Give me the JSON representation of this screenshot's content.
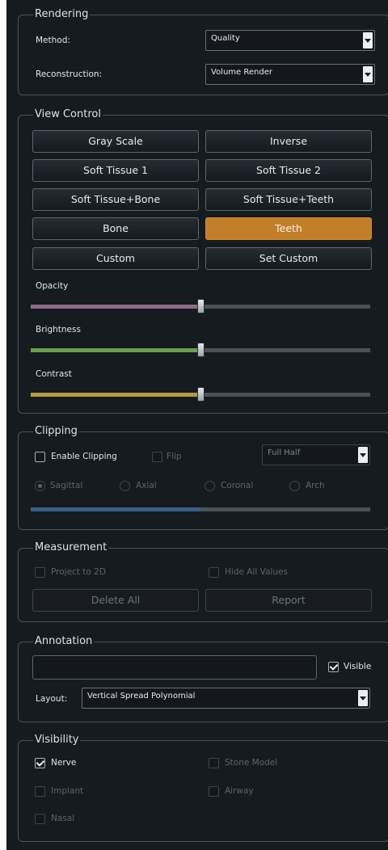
{
  "rendering": {
    "title": "Rendering",
    "method_label": "Method:",
    "method_value": "Quality",
    "reconstruction_label": "Reconstruction:",
    "reconstruction_value": "Volume Render"
  },
  "view_control": {
    "title": "View Control",
    "buttons": [
      "Gray Scale",
      "Inverse",
      "Soft Tissue 1",
      "Soft Tissue 2",
      "Soft Tissue+Bone",
      "Soft Tissue+Teeth",
      "Bone",
      "Teeth",
      "Custom",
      "Set Custom"
    ],
    "active_button": "Teeth",
    "opacity_label": "Opacity",
    "brightness_label": "Brightness",
    "contrast_label": "Contrast",
    "opacity_value": 0.5,
    "brightness_value": 0.5,
    "contrast_value": 0.5,
    "colors": {
      "opacity": "#8f6b85",
      "brightness": "#6aa04a",
      "contrast": "#b59a42",
      "active": "#c27e28"
    }
  },
  "clipping": {
    "title": "Clipping",
    "enable_label": "Enable Clipping",
    "enable_checked": false,
    "flip_label": "Flip",
    "mode_value": "Full Half",
    "planes": [
      "Sagittal",
      "Axial",
      "Coronal",
      "Arch"
    ],
    "selected_plane": "Sagittal",
    "position_value": 0.5,
    "colors": {
      "position": "#3a5f8a"
    }
  },
  "measurement": {
    "title": "Measurement",
    "project_label": "Project to 2D",
    "hide_values_label": "Hide All Values",
    "delete_label": "Delete All",
    "report_label": "Report"
  },
  "annotation": {
    "title": "Annotation",
    "text_value": "",
    "visible_label": "Visible",
    "visible_checked": true,
    "layout_label": "Layout:",
    "layout_value": "Vertical Spread Polynomial"
  },
  "visibility": {
    "title": "Visibility",
    "items": [
      {
        "label": "Nerve",
        "checked": true,
        "enabled": true
      },
      {
        "label": "Stone Model",
        "checked": false,
        "enabled": false
      },
      {
        "label": "Implant",
        "checked": false,
        "enabled": false
      },
      {
        "label": "Airway",
        "checked": false,
        "enabled": false
      },
      {
        "label": "Nasal",
        "checked": false,
        "enabled": false
      }
    ]
  }
}
